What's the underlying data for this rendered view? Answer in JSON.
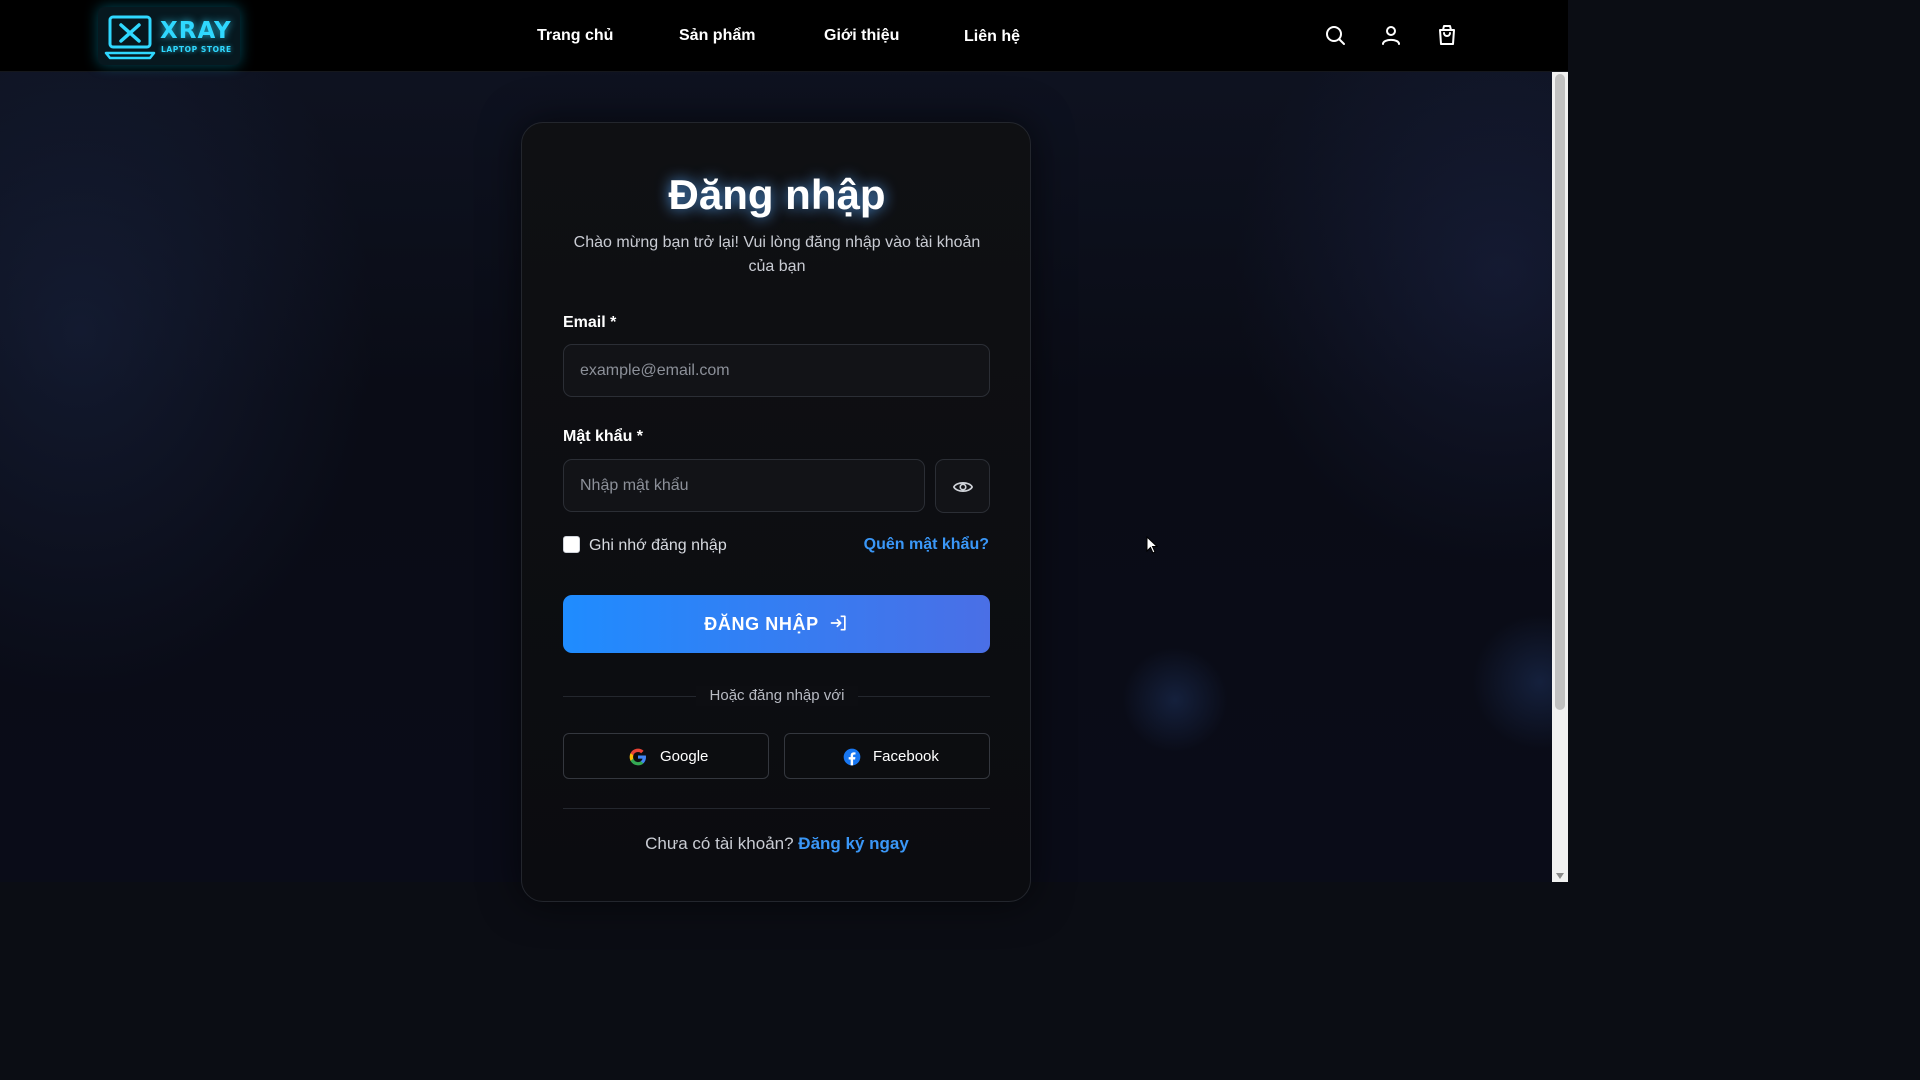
{
  "brand": {
    "name": "XRAY",
    "tagline": "LAPTOP STORE",
    "accent_color": "#2fd8ff"
  },
  "nav": {
    "items": [
      {
        "label": "Trang chủ"
      },
      {
        "label": "Sản phẩm"
      },
      {
        "label": "Giới thiệu"
      },
      {
        "label": "Liên hệ"
      }
    ],
    "icons": [
      "search-icon",
      "user-icon",
      "shopping-bag-icon"
    ]
  },
  "login": {
    "title": "Đăng nhập",
    "subtitle": "Chào mừng bạn trở lại! Vui lòng đăng nhập vào tài khoản của bạn",
    "email_label": "Email *",
    "email_placeholder": "example@email.com",
    "email_value": "",
    "password_label": "Mật khẩu *",
    "password_placeholder": "Nhập mật khẩu",
    "password_value": "",
    "remember_label": "Ghi nhớ đăng nhập",
    "remember_checked": false,
    "forgot_label": "Quên mật khẩu?",
    "submit_label": "ĐĂNG NHẬP",
    "divider_text": "Hoặc đăng nhập với",
    "google_label": "Google",
    "facebook_label": "Facebook",
    "signup_prompt": "Chưa có tài khoản?",
    "signup_link": "Đăng ký ngay"
  },
  "colors": {
    "primary_button_start": "#1f8cff",
    "primary_button_end": "#4a6fe6",
    "link": "#3a97f7",
    "facebook": "#1877f2"
  }
}
